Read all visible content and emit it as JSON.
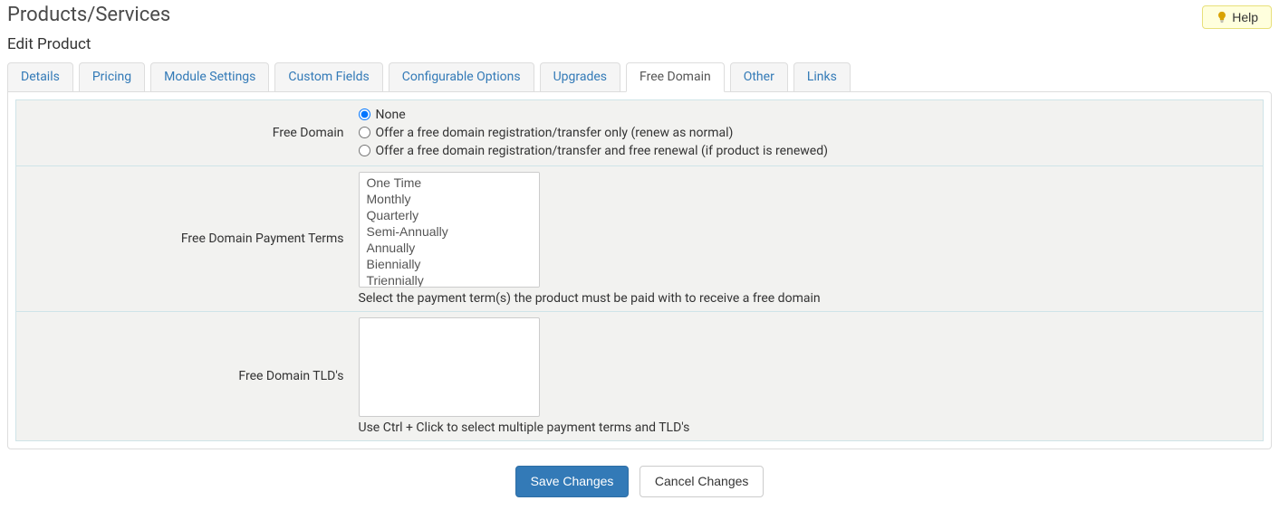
{
  "page": {
    "title": "Products/Services",
    "subtitle": "Edit Product",
    "help_label": "Help"
  },
  "tabs": [
    {
      "label": "Details",
      "active": false
    },
    {
      "label": "Pricing",
      "active": false
    },
    {
      "label": "Module Settings",
      "active": false
    },
    {
      "label": "Custom Fields",
      "active": false
    },
    {
      "label": "Configurable Options",
      "active": false
    },
    {
      "label": "Upgrades",
      "active": false
    },
    {
      "label": "Free Domain",
      "active": true
    },
    {
      "label": "Other",
      "active": false
    },
    {
      "label": "Links",
      "active": false
    }
  ],
  "form": {
    "free_domain": {
      "label": "Free Domain",
      "options": [
        "None",
        "Offer a free domain registration/transfer only (renew as normal)",
        "Offer a free domain registration/transfer and free renewal (if product is renewed)"
      ],
      "selected": 0
    },
    "payment_terms": {
      "label": "Free Domain Payment Terms",
      "options": [
        "One Time",
        "Monthly",
        "Quarterly",
        "Semi-Annually",
        "Annually",
        "Biennially",
        "Triennially"
      ],
      "hint": "Select the payment term(s) the product must be paid with to receive a free domain"
    },
    "tlds": {
      "label": "Free Domain TLD's",
      "options": [],
      "hint": "Use Ctrl + Click to select multiple payment terms and TLD's"
    }
  },
  "buttons": {
    "save": "Save Changes",
    "cancel": "Cancel Changes"
  }
}
